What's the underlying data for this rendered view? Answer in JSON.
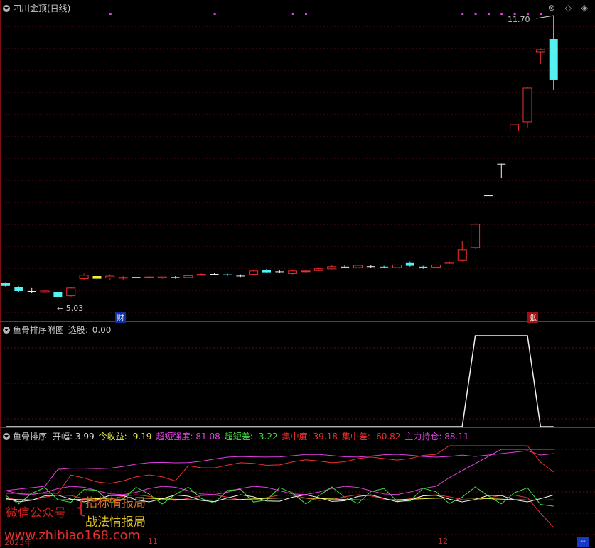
{
  "panel1": {
    "title": "四川金顶(日线)",
    "high_label": "11.70",
    "low_label": "5.03",
    "badge_cai": "财",
    "badge_zhang": "张",
    "icons": [
      "close-circle-icon",
      "diamond-icon",
      "double-diamond-icon"
    ],
    "candles": [
      {
        "o": 5.42,
        "c": 5.35,
        "h": 5.44,
        "l": 5.32,
        "color": "cyan"
      },
      {
        "o": 5.33,
        "c": 5.23,
        "h": 5.34,
        "l": 5.2,
        "color": "cyan"
      },
      {
        "o": 5.23,
        "c": 5.22,
        "h": 5.3,
        "l": 5.18,
        "color": "white"
      },
      {
        "o": 5.2,
        "c": 5.23,
        "h": 5.25,
        "l": 5.18,
        "color": "red"
      },
      {
        "o": 5.2,
        "c": 5.08,
        "h": 5.22,
        "l": 5.03,
        "color": "cyan"
      },
      {
        "o": 5.12,
        "c": 5.3,
        "h": 5.32,
        "l": 5.1,
        "color": "red"
      },
      {
        "o": 5.52,
        "c": 5.6,
        "h": 5.64,
        "l": 5.5,
        "color": "red"
      },
      {
        "o": 5.58,
        "c": 5.52,
        "h": 5.6,
        "l": 5.48,
        "color": "yellow"
      },
      {
        "o": 5.54,
        "c": 5.58,
        "h": 5.62,
        "l": 5.5,
        "color": "red"
      },
      {
        "o": 5.54,
        "c": 5.55,
        "h": 5.58,
        "l": 5.5,
        "color": "red"
      },
      {
        "o": 5.55,
        "c": 5.56,
        "h": 5.58,
        "l": 5.52,
        "color": "white"
      },
      {
        "o": 5.55,
        "c": 5.56,
        "h": 5.58,
        "l": 5.53,
        "color": "red"
      },
      {
        "o": 5.54,
        "c": 5.56,
        "h": 5.57,
        "l": 5.52,
        "color": "red"
      },
      {
        "o": 5.56,
        "c": 5.54,
        "h": 5.58,
        "l": 5.52,
        "color": "cyan"
      },
      {
        "o": 5.55,
        "c": 5.59,
        "h": 5.61,
        "l": 5.53,
        "color": "red"
      },
      {
        "o": 5.6,
        "c": 5.62,
        "h": 5.64,
        "l": 5.59,
        "color": "red"
      },
      {
        "o": 5.63,
        "c": 5.63,
        "h": 5.66,
        "l": 5.61,
        "color": "white"
      },
      {
        "o": 5.62,
        "c": 5.6,
        "h": 5.64,
        "l": 5.58,
        "color": "cyan"
      },
      {
        "o": 5.59,
        "c": 5.59,
        "h": 5.62,
        "l": 5.56,
        "color": "white"
      },
      {
        "o": 5.62,
        "c": 5.7,
        "h": 5.72,
        "l": 5.61,
        "color": "red"
      },
      {
        "o": 5.72,
        "c": 5.67,
        "h": 5.75,
        "l": 5.65,
        "color": "cyan"
      },
      {
        "o": 5.68,
        "c": 5.69,
        "h": 5.72,
        "l": 5.66,
        "color": "white"
      },
      {
        "o": 5.64,
        "c": 5.7,
        "h": 5.72,
        "l": 5.62,
        "color": "red"
      },
      {
        "o": 5.69,
        "c": 5.7,
        "h": 5.72,
        "l": 5.66,
        "color": "red"
      },
      {
        "o": 5.71,
        "c": 5.75,
        "h": 5.78,
        "l": 5.7,
        "color": "red"
      },
      {
        "o": 5.75,
        "c": 5.8,
        "h": 5.84,
        "l": 5.74,
        "color": "red"
      },
      {
        "o": 5.8,
        "c": 5.8,
        "h": 5.83,
        "l": 5.78,
        "color": "white"
      },
      {
        "o": 5.78,
        "c": 5.83,
        "h": 5.85,
        "l": 5.77,
        "color": "red"
      },
      {
        "o": 5.81,
        "c": 5.81,
        "h": 5.83,
        "l": 5.78,
        "color": "white"
      },
      {
        "o": 5.8,
        "c": 5.79,
        "h": 5.82,
        "l": 5.77,
        "color": "cyan"
      },
      {
        "o": 5.78,
        "c": 5.84,
        "h": 5.86,
        "l": 5.77,
        "color": "red"
      },
      {
        "o": 5.9,
        "c": 5.82,
        "h": 5.92,
        "l": 5.8,
        "color": "cyan"
      },
      {
        "o": 5.8,
        "c": 5.77,
        "h": 5.82,
        "l": 5.75,
        "color": "cyan"
      },
      {
        "o": 5.79,
        "c": 5.84,
        "h": 5.86,
        "l": 5.78,
        "color": "red"
      },
      {
        "o": 5.88,
        "c": 5.9,
        "h": 5.94,
        "l": 5.86,
        "color": "red"
      },
      {
        "o": 5.96,
        "c": 6.2,
        "h": 6.4,
        "l": 5.92,
        "color": "red"
      },
      {
        "o": 6.25,
        "c": 6.8,
        "h": 6.82,
        "l": 6.22,
        "color": "red"
      },
      {
        "o": 7.48,
        "c": 7.48,
        "h": 7.48,
        "l": 7.48,
        "color": "white"
      },
      {
        "o": 8.22,
        "c": 8.22,
        "h": 8.22,
        "l": 7.88,
        "color": "white"
      },
      {
        "o": 8.99,
        "c": 9.15,
        "h": 9.15,
        "l": 8.99,
        "color": "red"
      },
      {
        "o": 9.2,
        "c": 10.0,
        "h": 10.02,
        "l": 9.05,
        "color": "red"
      },
      {
        "o": 10.85,
        "c": 10.9,
        "h": 10.92,
        "l": 10.57,
        "color": "red"
      },
      {
        "o": 11.15,
        "c": 10.2,
        "h": 11.7,
        "l": 9.95,
        "color": "cyan"
      }
    ],
    "markers": [
      8,
      16,
      22,
      23,
      35,
      36,
      37,
      38,
      39,
      40,
      41
    ]
  },
  "panel2": {
    "title": "鱼骨排序附图",
    "field_label": "选股:",
    "field_value": "0.00",
    "signal": [
      0,
      0,
      0,
      0,
      0,
      0,
      0,
      0,
      0,
      0,
      0,
      0,
      0,
      0,
      0,
      0,
      0,
      0,
      0,
      0,
      0,
      0,
      0,
      0,
      0,
      0,
      0,
      0,
      0,
      0,
      0,
      0,
      0,
      0,
      0,
      0,
      1,
      1,
      1,
      1,
      1,
      0,
      0
    ]
  },
  "panel3": {
    "title": "鱼骨排序",
    "fields": [
      {
        "label": "开幅:",
        "value": "3.99",
        "color": "#d8d8d8"
      },
      {
        "label": "今收益:",
        "value": "-9.19",
        "color": "#e8e848"
      },
      {
        "label": "超短强度:",
        "value": "81.08",
        "color": "#e040e0"
      },
      {
        "label": "超短差:",
        "value": "-3.22",
        "color": "#40e040"
      },
      {
        "label": "集中度:",
        "value": "39.18",
        "color": "#f03030"
      },
      {
        "label": "集中差:",
        "value": "-60.82",
        "color": "#f03030"
      },
      {
        "label": "主力持仓:",
        "value": "88.11",
        "color": "#e040e0"
      }
    ]
  },
  "xaxis": {
    "labels": [
      "2023年",
      "11",
      "12"
    ]
  },
  "scroll_label": "--",
  "watermark": {
    "line_a": "微信公众号",
    "brace": "{",
    "line_b": "指标情报局",
    "line_c": "战法情报局",
    "line_d": "www.zhibiao168.com"
  }
}
